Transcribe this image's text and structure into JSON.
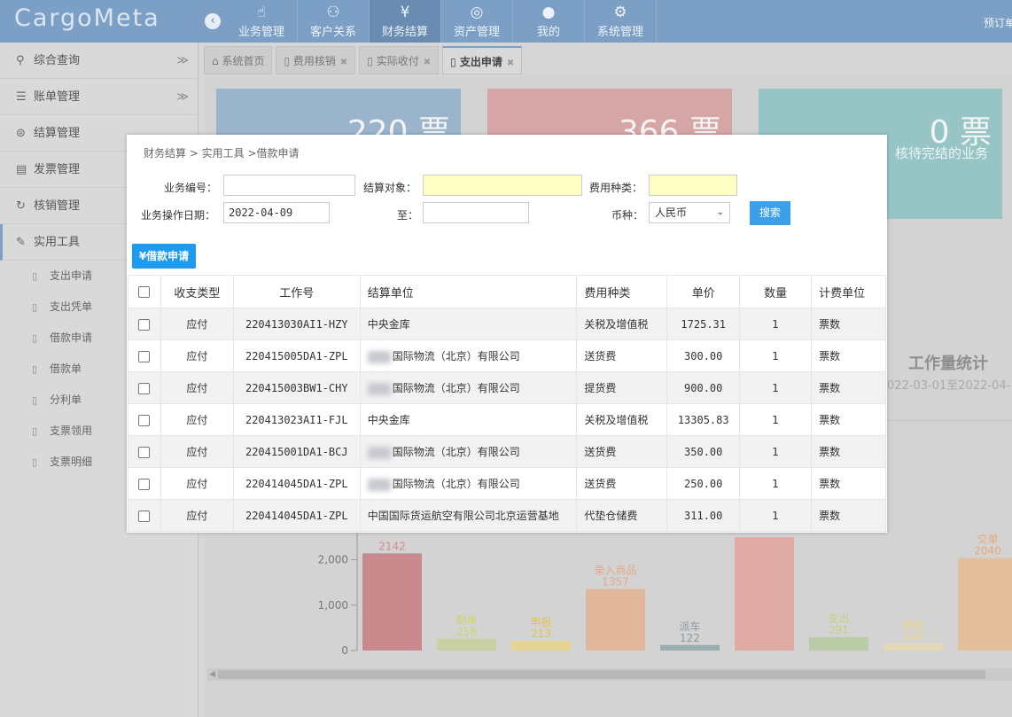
{
  "app": {
    "logo": "CargoMeta",
    "preorder": "预订单"
  },
  "topnav": [
    {
      "label": "业务管理",
      "icon": "hand-pointer-icon",
      "glyph": "☝"
    },
    {
      "label": "客户关系",
      "icon": "handshake-icon",
      "glyph": "⚇"
    },
    {
      "label": "财务结算",
      "icon": "yen-icon",
      "glyph": "¥"
    },
    {
      "label": "资产管理",
      "icon": "basketball-icon",
      "glyph": "◎"
    },
    {
      "label": "我的",
      "icon": "user-icon",
      "glyph": "●"
    },
    {
      "label": "系统管理",
      "icon": "gear-icon",
      "glyph": "⚙"
    }
  ],
  "sidebar": {
    "items": [
      {
        "label": "综合查询",
        "icon": "search-icon",
        "glyph": "⚲",
        "chevron": "≫"
      },
      {
        "label": "账单管理",
        "icon": "list-icon",
        "glyph": "☰",
        "chevron": "≫"
      },
      {
        "label": "结算管理",
        "icon": "coins-icon",
        "glyph": "⊜"
      },
      {
        "label": "发票管理",
        "icon": "invoice-icon",
        "glyph": "▤"
      },
      {
        "label": "核销管理",
        "icon": "refresh-icon",
        "glyph": "↻"
      },
      {
        "label": "实用工具",
        "icon": "wrench-icon",
        "glyph": "✎"
      }
    ],
    "subitems": [
      "支出申请",
      "支出凭单",
      "借款申请",
      "借款单",
      "分利单",
      "支票领用",
      "支票明细"
    ]
  },
  "tabs": [
    {
      "label": "系统首页",
      "icon": "home-icon",
      "closable": false
    },
    {
      "label": "费用核销",
      "icon": "document-icon",
      "closable": true
    },
    {
      "label": "实际收付",
      "icon": "document-icon",
      "closable": true
    },
    {
      "label": "支出申请",
      "icon": "document-icon",
      "closable": true,
      "active": true
    }
  ],
  "dashboard": {
    "cards": [
      {
        "value": "220 票"
      },
      {
        "value": "366 票"
      },
      {
        "value": "0 票",
        "caption": "核待完结的业务"
      }
    ],
    "workload_title": "工作量统计",
    "workload_range": "022-03-01至2022-04-"
  },
  "chart_data": {
    "type": "bar",
    "categories": [
      "",
      "制单",
      "申报",
      "录入商品",
      "派车",
      "",
      "支出",
      "借款",
      "交单"
    ],
    "values": [
      2142,
      258,
      213,
      1357,
      122,
      2500,
      291,
      146,
      2040
    ],
    "value_labels": [
      "2142",
      "258",
      "213",
      "1357",
      "122",
      "",
      "291",
      "146",
      "2040"
    ],
    "colors": [
      "#c98a8e",
      "#cbd0a4",
      "#e5d394",
      "#e0b79b",
      "#97adb0",
      "#e0aba5",
      "#b9cca6",
      "#e5d8b7",
      "#e4bf9b"
    ],
    "label_colors": [
      "#d68c92",
      "#cdd56a",
      "#e3c355",
      "#e6a98b",
      "#8d9a9c",
      "",
      "#bfd47e",
      "#e8d48c",
      "#e8a87b"
    ],
    "ylim": [
      0,
      2500
    ],
    "yticks": [
      "0",
      "1,000",
      "2,000"
    ]
  },
  "modal": {
    "breadcrumb": "财务结算 > 实用工具 >借款申请",
    "form": {
      "biz_no_label": "业务编号：",
      "biz_no_value": "",
      "settle_target_label": "结算对象：",
      "settle_target_value": "",
      "fee_type_label": "费用种类：",
      "fee_type_value": "",
      "op_date_label": "业务操作日期：",
      "op_date_value": "2022-04-09",
      "to_label": "至：",
      "to_value": "",
      "currency_label": "币种：",
      "currency_value": "人民币",
      "search_button": "搜索"
    },
    "loan_button": "¥借款申请",
    "table": {
      "headers": [
        "收支类型",
        "工作号",
        "结算单位",
        "费用种类",
        "单价",
        "数量",
        "计费单位"
      ],
      "rows": [
        {
          "type": "应付",
          "job": "220413030AI1-HZY",
          "unit": "中央金库",
          "blurred": false,
          "fee": "关税及增值税",
          "price": "1725.31",
          "qty": "1",
          "uom": "票数"
        },
        {
          "type": "应付",
          "job": "220415005DA1-ZPL",
          "unit": "国际物流（北京）有限公司",
          "blurred": true,
          "fee": "送货费",
          "price": "300.00",
          "qty": "1",
          "uom": "票数"
        },
        {
          "type": "应付",
          "job": "220415003BW1-CHY",
          "unit": "国际物流（北京）有限公司",
          "blurred": true,
          "fee": "提货费",
          "price": "900.00",
          "qty": "1",
          "uom": "票数"
        },
        {
          "type": "应付",
          "job": "220413023AI1-FJL",
          "unit": "中央金库",
          "blurred": false,
          "fee": "关税及增值税",
          "price": "13305.83",
          "qty": "1",
          "uom": "票数"
        },
        {
          "type": "应付",
          "job": "220415001DA1-BCJ",
          "unit": "国际物流（北京）有限公司",
          "blurred": true,
          "fee": "送货费",
          "price": "350.00",
          "qty": "1",
          "uom": "票数"
        },
        {
          "type": "应付",
          "job": "220414045DA1-ZPL",
          "unit": "国际物流（北京）有限公司",
          "blurred": true,
          "fee": "送货费",
          "price": "250.00",
          "qty": "1",
          "uom": "票数"
        },
        {
          "type": "应付",
          "job": "220414045DA1-ZPL",
          "unit": "中国国际货运航空有限公司北京运营基地",
          "blurred": false,
          "fee": "代垫仓储费",
          "price": "311.00",
          "qty": "1",
          "uom": "票数"
        }
      ]
    }
  }
}
